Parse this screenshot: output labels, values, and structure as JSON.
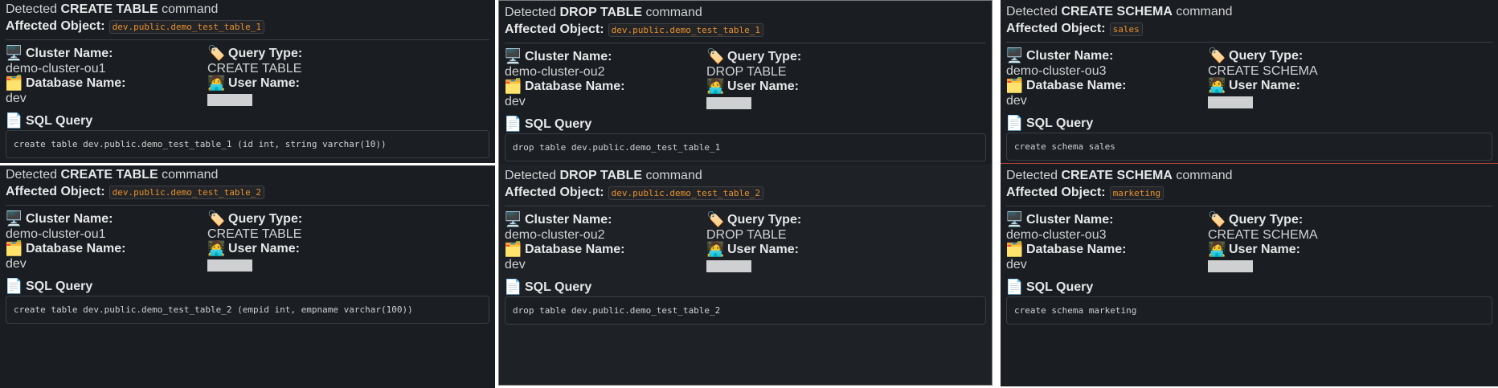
{
  "labels": {
    "detected_prefix": "Detected",
    "command_suffix": "command",
    "affected_object": "Affected Object:",
    "cluster_name": "Cluster Name:",
    "query_type": "Query Type:",
    "database_name": "Database Name:",
    "user_name": "User Name:",
    "sql_query": "SQL Query"
  },
  "icons": {
    "cluster": "🖥️",
    "query_type": "🏷️",
    "database": "🗂️",
    "user": "🧑‍💻",
    "sql": "📄"
  },
  "colors": {
    "card_bg": "#1a1d21",
    "code_orange": "#e8912d",
    "text": "#d1d2d3"
  },
  "columns": [
    {
      "cards": [
        {
          "command": "CREATE TABLE",
          "object": "dev.public.demo_test_table_1",
          "cluster": "demo-cluster-ou1",
          "query_type": "CREATE TABLE",
          "database": "dev",
          "sql": "create table dev.public.demo_test_table_1  (id int, string varchar(10))"
        },
        {
          "command": "CREATE TABLE",
          "object": "dev.public.demo_test_table_2",
          "cluster": "demo-cluster-ou1",
          "query_type": "CREATE TABLE",
          "database": "dev",
          "sql": "create table dev.public.demo_test_table_2  (empid int, empname varchar(100))"
        }
      ]
    },
    {
      "cards": [
        {
          "command": "DROP TABLE",
          "object": "dev.public.demo_test_table_1",
          "cluster": "demo-cluster-ou2",
          "query_type": "DROP TABLE",
          "database": "dev",
          "sql": "drop table dev.public.demo_test_table_1"
        },
        {
          "command": "DROP TABLE",
          "object": "dev.public.demo_test_table_2",
          "cluster": "demo-cluster-ou2",
          "query_type": "DROP TABLE",
          "database": "dev",
          "sql": "drop table dev.public.demo_test_table_2"
        }
      ]
    },
    {
      "cards": [
        {
          "command": "CREATE SCHEMA",
          "object": "sales",
          "cluster": "demo-cluster-ou3",
          "query_type": "CREATE SCHEMA",
          "database": "dev",
          "sql": "create schema sales"
        },
        {
          "command": "CREATE SCHEMA",
          "object": "marketing",
          "cluster": "demo-cluster-ou3",
          "query_type": "CREATE SCHEMA",
          "database": "dev",
          "sql": "create schema marketing"
        }
      ]
    }
  ]
}
